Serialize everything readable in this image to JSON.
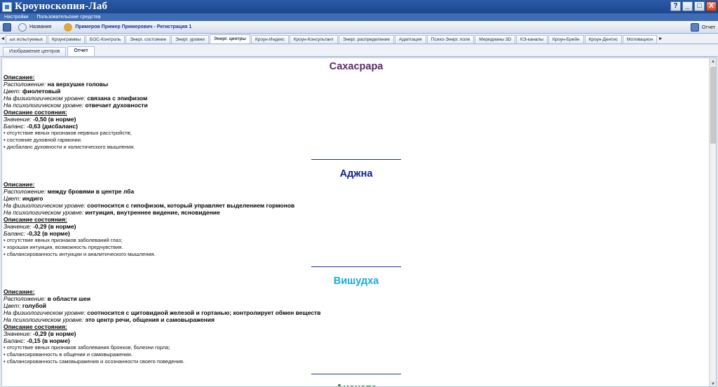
{
  "app": {
    "title": "Кроуноскопия-Лаб"
  },
  "window_buttons": {
    "help": "?",
    "minimize": "_",
    "maximize": "□",
    "close": "X"
  },
  "menu": [
    "Настройки",
    "Пользовательские средства"
  ],
  "toolbar": {
    "names_label": "Названия",
    "user_text": "Примеров Пример Примерович - Регистрация 1",
    "report_label": "Отчет"
  },
  "tabs": [
    "ых испытуемых",
    "Кроунграммы",
    "БОС-Контроль",
    "Энерг. состояние",
    "Энерг. уровни",
    "Энерг. центры",
    "Кроун-Индекс",
    "Кроун-Консультант",
    "Энерг. распределение",
    "Адаптация",
    "Психо-Энерг. поле",
    "Меридианы 3D",
    "КЭ-каналы",
    "Кроун-Брейн",
    "Кроун-Дентис",
    "Мотивацион"
  ],
  "active_tab_index": 5,
  "subtabs": [
    "Изображение центров",
    "Отчет"
  ],
  "active_subtab_index": 1,
  "labels": {
    "description": "Описание:",
    "location": "Расположение:",
    "color": "Цвет:",
    "physio": "На физиологическом уровне:",
    "psycho": "На психологическом уровне:",
    "state": "Описание состояния:",
    "value": "Значение:",
    "balance": "Баланс:"
  },
  "centers": [
    {
      "name": "Сахасрара",
      "color_hex": "#5b2a6e",
      "location": "на верхушке головы",
      "color": "фиолетовый",
      "physio": "связана с эпифизом",
      "psycho": "отвечает духовности",
      "value": "-0,50  (в норме)",
      "balance": "-0,63  (дисбаланс)",
      "bullets": [
        "• отсутствие явных признаков нервных расстройств;",
        "• состояние духовной гармонии.",
        "• дисбаланс духовности и холистического мышления."
      ]
    },
    {
      "name": "Аджна",
      "color_hex": "#0d1f8c",
      "location": "между бровями в центре лба",
      "color": "индиго",
      "physio": "соотносится с гипофизом, который управляет выделением гормонов",
      "psycho": "интуиция, внутреннее видение, ясновидение",
      "value": "-0,29  (в норме)",
      "balance": "-0,32  (в норме)",
      "bullets": [
        "• отсутствие явных признаков заболеваний глаз;",
        "• хорошая интуиция, возможность предчувствия.",
        "• сбалансированность интуиции и аналитического мышления."
      ]
    },
    {
      "name": "Вишудха",
      "color_hex": "#19a9e0",
      "location": "в области шеи",
      "color": "голубой",
      "physio": "соотносится с щитовидной железой и гортанью; контролирует обмен веществ",
      "psycho": "это центр речи, общения и самовыражения",
      "value": "-0,29  (в норме)",
      "balance": "-0,15  (в норме)",
      "bullets": [
        "• отсутствие явных признаков заболевания бронхов, болезни горла;",
        "• сбалансированность в общении и самовыражении.",
        "• сбалансированность самовыражения и осознанности своего поведения."
      ]
    },
    {
      "name": "Анахата",
      "color_hex": "#1e7a1e"
    }
  ]
}
